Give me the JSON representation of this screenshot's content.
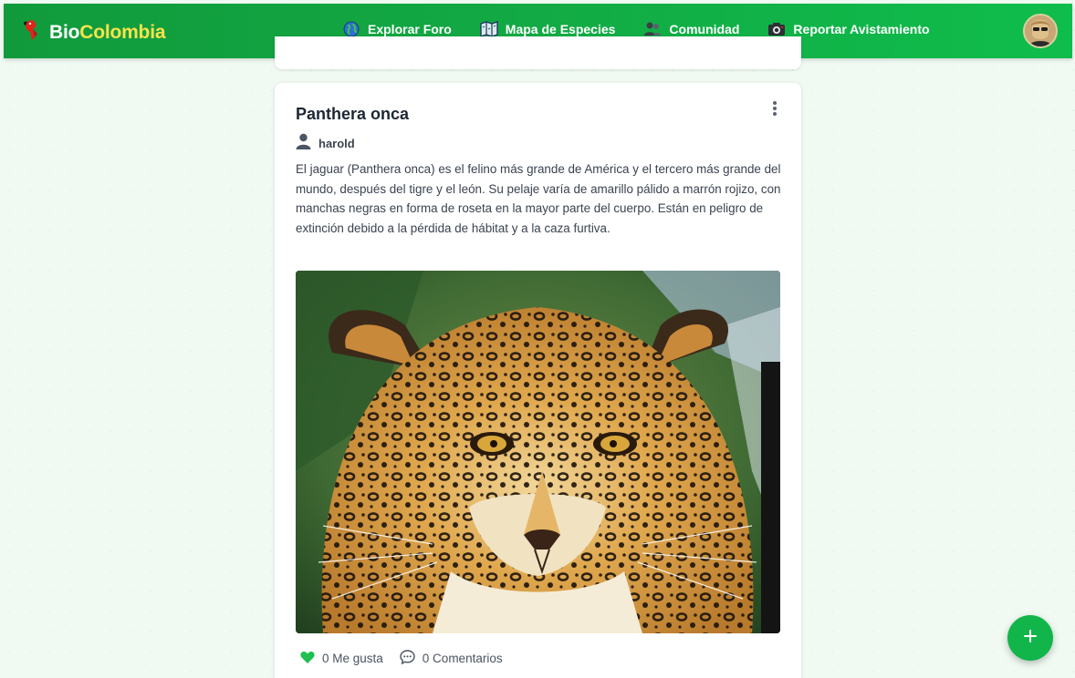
{
  "brand": {
    "part1": "Bio",
    "part2": "Colombia",
    "logo_icon": "parrot-icon"
  },
  "nav": {
    "items": [
      {
        "label": "Explorar Foro",
        "icon": "globe-icon"
      },
      {
        "label": "Mapa de Especies",
        "icon": "map-icon"
      },
      {
        "label": "Comunidad",
        "icon": "people-icon"
      },
      {
        "label": "Reportar Avistamiento",
        "icon": "camera-icon"
      }
    ],
    "avatar_icon": "user-avatar"
  },
  "post": {
    "title": "Panthera onca",
    "author": "harold",
    "body": "El jaguar (Panthera onca) es el felino más grande de América y el tercero más grande del mundo, después del tigre y el león. Su pelaje varía de amarillo pálido a marrón rojizo, con manchas negras en forma de roseta en la mayor parte del cuerpo. Están en peligro de extinción debido a la pérdida de hábitat y a la caza furtiva.",
    "image_subject": "jaguar-photo",
    "likes_label": "0 Me gusta",
    "comments_label": "0 Comentarios"
  },
  "fab": {
    "icon": "plus-icon"
  },
  "colors": {
    "nav_start": "#119a3c",
    "nav_end": "#0fbd4c",
    "brand_accent": "#f7e34a",
    "fab": "#12b54a",
    "like_heart": "#1fbf52"
  }
}
